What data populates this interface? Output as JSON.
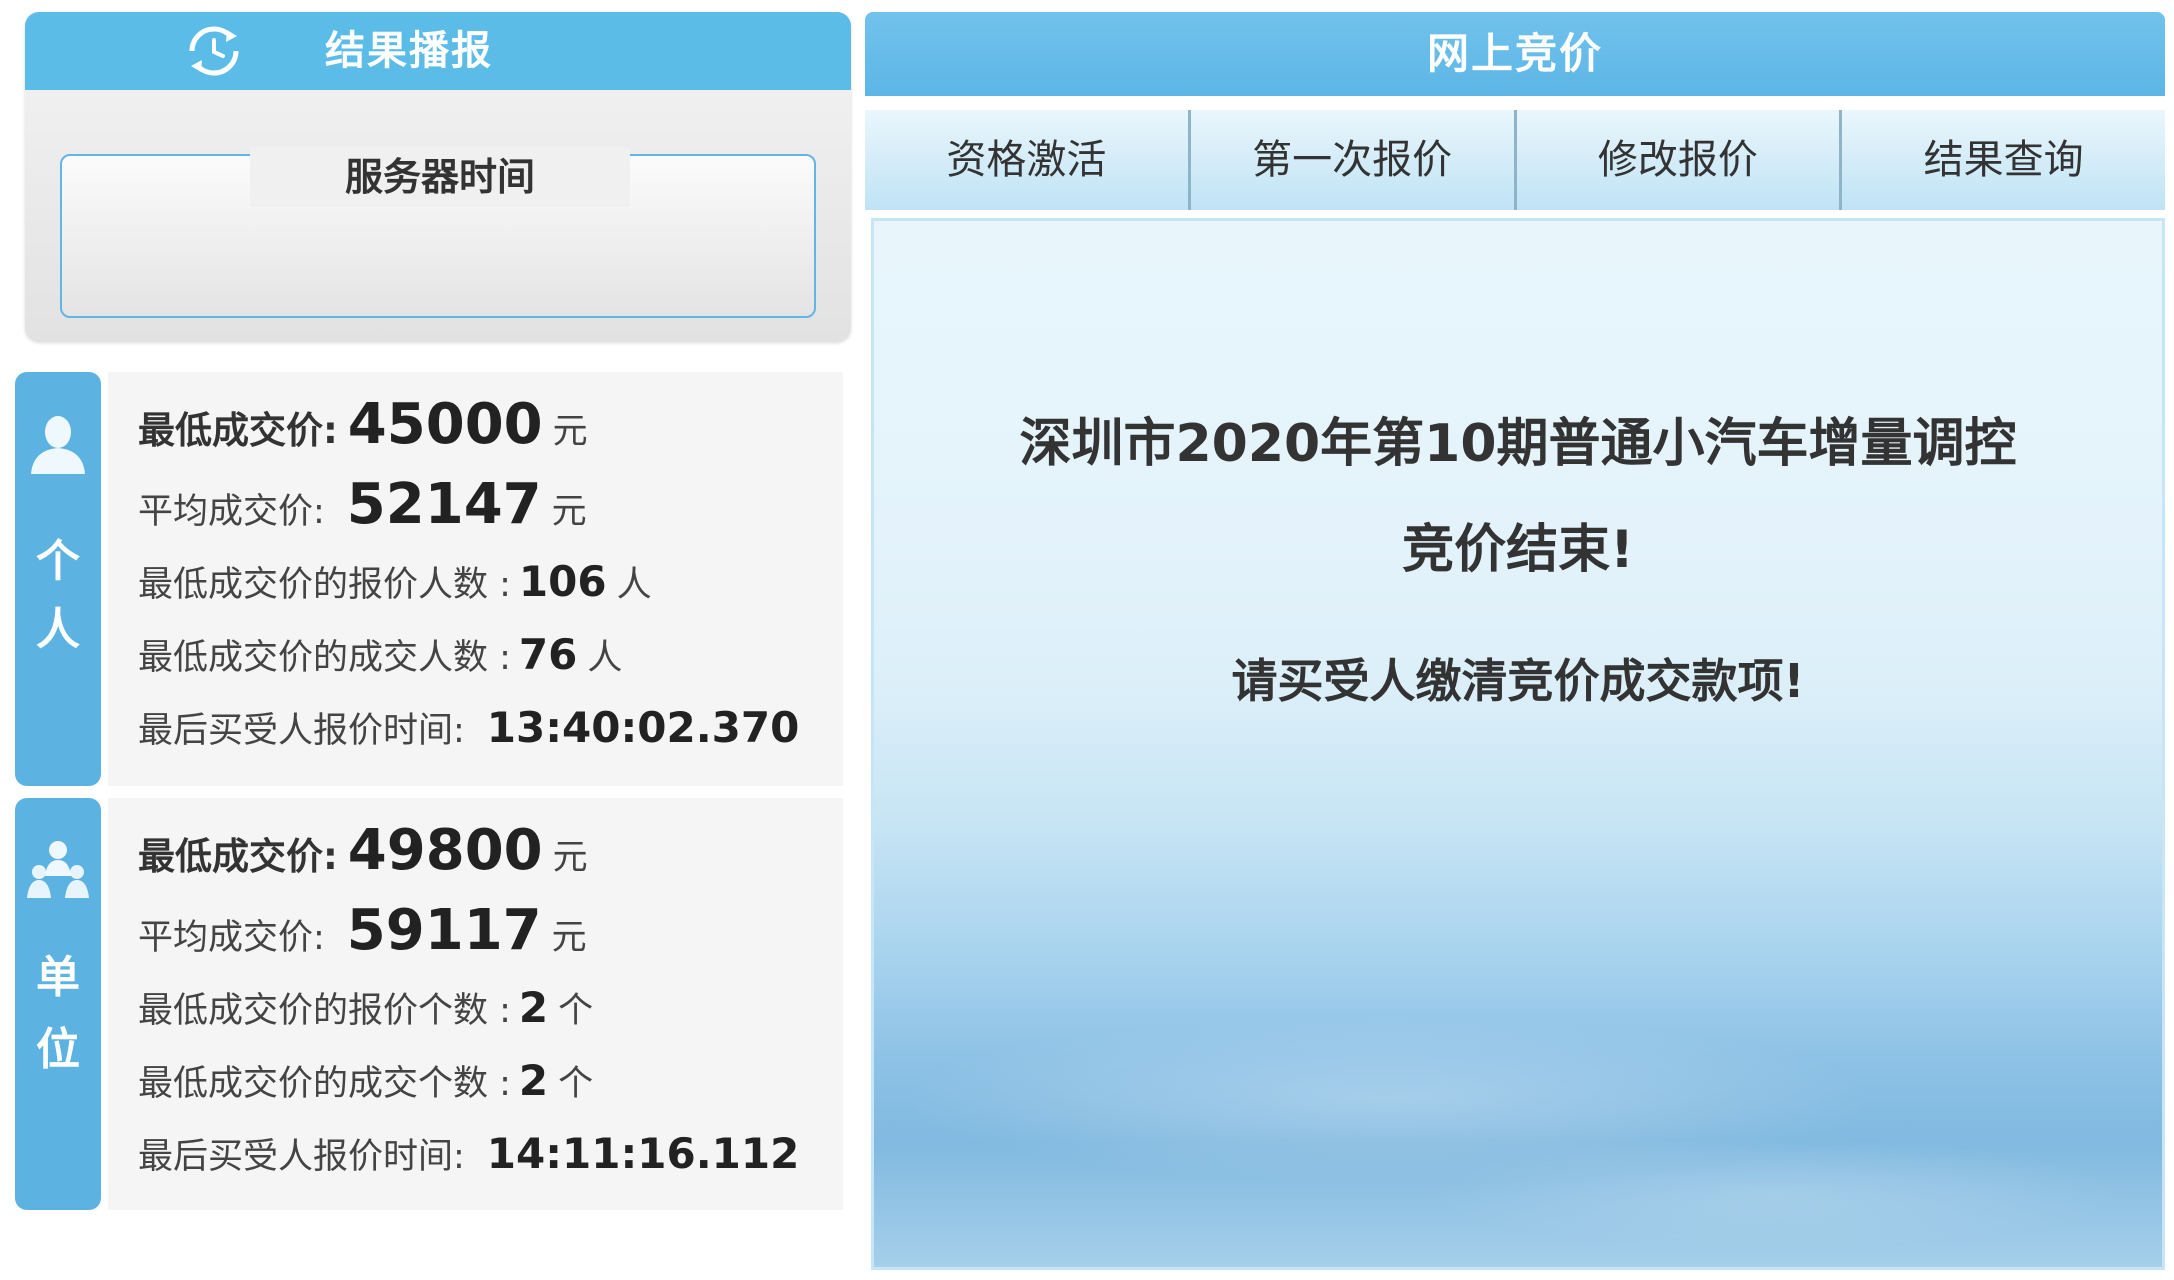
{
  "broadcast": {
    "title": "结果播报",
    "server_time_label": "服务器时间",
    "server_time_value": ""
  },
  "individual": {
    "tab_chars": [
      "个",
      "人"
    ],
    "lowest_price_label": "最低成交价:",
    "lowest_price_value": "45000",
    "avg_price_label": "平均成交价:",
    "avg_price_value": "52147",
    "lowest_bidders_label": "最低成交价的报价人数 :",
    "lowest_bidders_value": "106",
    "lowest_deals_label": "最低成交价的成交人数 :",
    "lowest_deals_value": "76",
    "last_bid_time_label": "最后买受人报价时间:",
    "last_bid_time_value": "13:40:02.370",
    "currency_unit": "元",
    "person_unit": "人"
  },
  "unit": {
    "tab_chars": [
      "单",
      "位"
    ],
    "lowest_price_label": "最低成交价:",
    "lowest_price_value": "49800",
    "avg_price_label": "平均成交价:",
    "avg_price_value": "59117",
    "lowest_bidders_label": "最低成交价的报价个数 :",
    "lowest_bidders_value": "2",
    "lowest_deals_label": "最低成交价的成交个数 :",
    "lowest_deals_value": "2",
    "last_bid_time_label": "最后买受人报价时间:",
    "last_bid_time_value": "14:11:16.112",
    "currency_unit": "元",
    "count_unit": "个"
  },
  "bidding": {
    "title": "网上竞价",
    "tabs": [
      "资格激活",
      "第一次报价",
      "修改报价",
      "结果查询"
    ],
    "message_line1": "深圳市2020年第10期普通小汽车增量调控",
    "message_line2": "竞价结束!",
    "message_line3": "请买受人缴清竞价成交款项!"
  },
  "colors": {
    "header_blue": "#5cbce8",
    "tab_blue": "#5cb3e2"
  }
}
